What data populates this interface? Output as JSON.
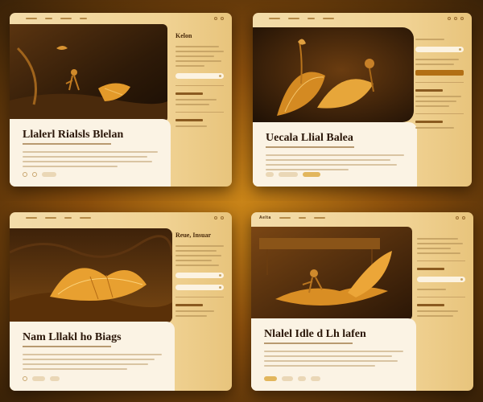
{
  "colors": {
    "background": "#8a4e0c",
    "panel": "#f0d293",
    "hero": "#fbf3e4",
    "accent": "#e2b65c",
    "dark_text": "#2a1608"
  },
  "panels": [
    {
      "brand": "",
      "hero_title": "Llalerl Rialsls Blelan",
      "side_title": "Kelon",
      "art_motif": "figure-and-leaf"
    },
    {
      "brand": "",
      "hero_title": "Uecala Llial Balea",
      "side_title": "",
      "art_motif": "pod-sculpture"
    },
    {
      "brand": "",
      "hero_title": "Nam Lllakl ho Biags",
      "side_title": "Reue, Insuar",
      "art_motif": "golden-leaf"
    },
    {
      "brand": "Aelta",
      "hero_title": "Nlalel Idle d Lh lafen",
      "side_title": "",
      "art_motif": "figure-in-boat"
    }
  ]
}
